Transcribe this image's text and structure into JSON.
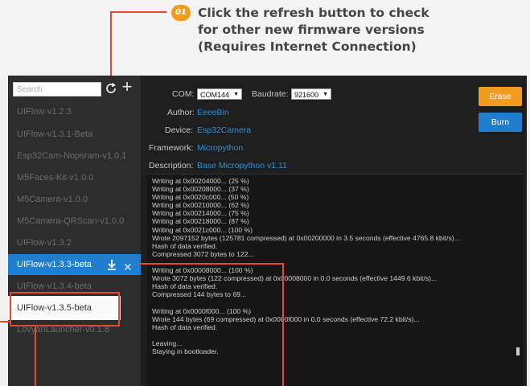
{
  "callout": {
    "badge": "01",
    "lines": [
      "Click the refresh button to check",
      "for other new firmware versions",
      "(Requires Internet Connection)"
    ]
  },
  "sidebar": {
    "search_placeholder": "Search",
    "items": [
      "UIFlow-v1.2.3",
      "UIFlow-v1.3.1-Beta",
      "Esp32Cam-Nopsram-v1.0.1",
      "M5Faces-Kit-v1.0.0",
      "M5Camera-v1.0.0",
      "M5Camera-QRScan-v1.0.0",
      "UIFlow-v1.3.2",
      "UIFlow-v1.3.3-beta",
      "UIFlow-v1.3.4-beta",
      "UIFlow-v1.3.5-beta",
      "LovyanLauncher-v0.1.8"
    ]
  },
  "main": {
    "com_label": "COM:",
    "com_value": "COM144",
    "baud_label": "Baudrate:",
    "baud_value": "921600",
    "author_label": "Author:",
    "author_value": "EeeeBin",
    "device_label": "Device:",
    "device_value": "Esp32Camera",
    "framework_label": "Framework:",
    "framework_value": "Micropython",
    "description_label": "Description:",
    "description_value": "Base Micropython v1.11",
    "erase_label": "Erase",
    "burn_label": "Burn"
  },
  "console": [
    "Writing at 0x00204000... (25 %)",
    "Writing at 0x00208000... (37 %)",
    "Writing at 0x0020c000... (50 %)",
    "Writing at 0x00210000... (62 %)",
    "Writing at 0x00214000... (75 %)",
    "Writing at 0x00218000... (87 %)",
    "Writing at 0x0021c000... (100 %)",
    "Wrote 2097152 bytes (125781 compressed) at 0x00200000 in 3.5 seconds (effective 4765.8 kbit/s)...",
    "Hash of data verified.",
    "Compressed 3072 bytes to 122...",
    "",
    "Writing at 0x00008000... (100 %)",
    "Wrote 3072 bytes (122 compressed) at 0x00008000 in 0.0 seconds (effective 1449.6 kbit/s)...",
    "Hash of data verified.",
    "Compressed 144 bytes to 69...",
    "",
    "Writing at 0x0000f000... (100 %)",
    "Wrote 144 bytes (69 compressed) at 0x0000f000 in 0.0 seconds (effective 72.2 kbit/s)...",
    "Hash of data verified.",
    "",
    "Leaving...",
    "Staying in bootloader."
  ],
  "colors": {
    "accent_blue": "#1f7fce",
    "accent_orange": "#f29c1f",
    "annotation_red": "#e8472c"
  }
}
